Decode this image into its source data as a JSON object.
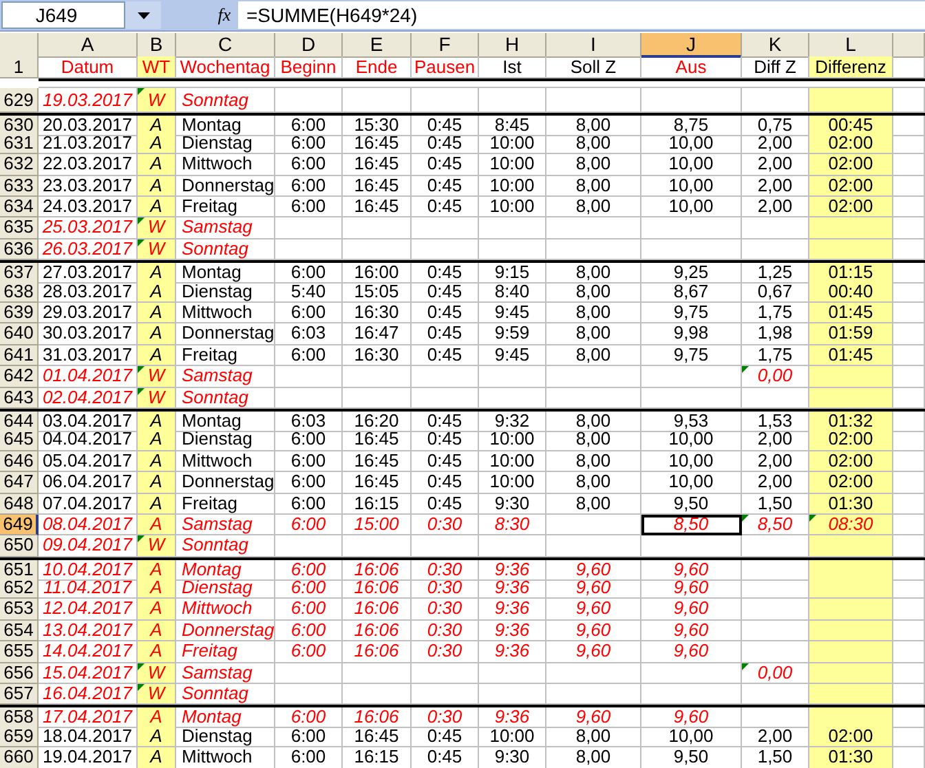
{
  "formula_bar": {
    "name_box": "J649",
    "fx_icon": "fx",
    "formula": "=SUMME(H649*24)"
  },
  "columns": [
    {
      "letter": "A",
      "selected": false,
      "highlight": false
    },
    {
      "letter": "B",
      "selected": false,
      "highlight": true
    },
    {
      "letter": "C",
      "selected": false,
      "highlight": false
    },
    {
      "letter": "D",
      "selected": false,
      "highlight": false
    },
    {
      "letter": "E",
      "selected": false,
      "highlight": false
    },
    {
      "letter": "F",
      "selected": false,
      "highlight": false
    },
    {
      "letter": "H",
      "selected": false,
      "highlight": false
    },
    {
      "letter": "I",
      "selected": false,
      "highlight": false
    },
    {
      "letter": "J",
      "selected": true,
      "highlight": false
    },
    {
      "letter": "K",
      "selected": false,
      "highlight": false
    },
    {
      "letter": "L",
      "selected": false,
      "highlight": true
    }
  ],
  "header_row": {
    "number": "1",
    "cells": [
      {
        "text": "Datum",
        "red": true
      },
      {
        "text": "WT",
        "red": true
      },
      {
        "text": "Wochentag",
        "red": true
      },
      {
        "text": "Beginn",
        "red": true
      },
      {
        "text": "Ende",
        "red": true
      },
      {
        "text": "Pausen",
        "red": true
      },
      {
        "text": "Ist",
        "red": false
      },
      {
        "text": "Soll Z",
        "red": false
      },
      {
        "text": "Aus",
        "red": true
      },
      {
        "text": "Diff Z",
        "red": false
      },
      {
        "text": "Differenz",
        "red": false
      }
    ]
  },
  "rows": [
    {
      "number": "629",
      "kind": "red",
      "selected": false,
      "separator_above": false,
      "comment_marks": {
        "B": true,
        "K": false,
        "L": false
      },
      "cells": {
        "A": "19.03.2017",
        "B": "W",
        "C": "Sonntag"
      }
    },
    {
      "number": "630",
      "kind": "plain",
      "selected": false,
      "separator_above": true,
      "comment_marks": {
        "B": false,
        "K": false,
        "L": false
      },
      "cells": {
        "A": "20.03.2017",
        "B": "A",
        "C": "Montag",
        "D": "6:00",
        "E": "15:30",
        "F": "0:45",
        "H": "8:45",
        "I": "8,00",
        "J": "8,75",
        "K": "0,75",
        "L": "00:45"
      }
    },
    {
      "number": "631",
      "kind": "plain",
      "selected": false,
      "separator_above": false,
      "comment_marks": {
        "B": false,
        "K": false,
        "L": false
      },
      "cells": {
        "A": "21.03.2017",
        "B": "A",
        "C": "Dienstag",
        "D": "6:00",
        "E": "16:45",
        "F": "0:45",
        "H": "10:00",
        "I": "8,00",
        "J": "10,00",
        "K": "2,00",
        "L": "02:00"
      }
    },
    {
      "number": "632",
      "kind": "plain",
      "selected": false,
      "separator_above": false,
      "comment_marks": {
        "B": false,
        "K": false,
        "L": false
      },
      "cells": {
        "A": "22.03.2017",
        "B": "A",
        "C": "Mittwoch",
        "D": "6:00",
        "E": "16:45",
        "F": "0:45",
        "H": "10:00",
        "I": "8,00",
        "J": "10,00",
        "K": "2,00",
        "L": "02:00"
      }
    },
    {
      "number": "633",
      "kind": "plain",
      "selected": false,
      "separator_above": false,
      "comment_marks": {
        "B": false,
        "K": false,
        "L": false
      },
      "cells": {
        "A": "23.03.2017",
        "B": "A",
        "C": "Donnerstag",
        "D": "6:00",
        "E": "16:45",
        "F": "0:45",
        "H": "10:00",
        "I": "8,00",
        "J": "10,00",
        "K": "2,00",
        "L": "02:00"
      }
    },
    {
      "number": "634",
      "kind": "plain",
      "selected": false,
      "separator_above": false,
      "comment_marks": {
        "B": false,
        "K": false,
        "L": false
      },
      "cells": {
        "A": "24.03.2017",
        "B": "A",
        "C": "Freitag",
        "D": "6:00",
        "E": "16:45",
        "F": "0:45",
        "H": "10:00",
        "I": "8,00",
        "J": "10,00",
        "K": "2,00",
        "L": "02:00"
      }
    },
    {
      "number": "635",
      "kind": "red",
      "selected": false,
      "separator_above": false,
      "comment_marks": {
        "B": true,
        "K": false,
        "L": false
      },
      "cells": {
        "A": "25.03.2017",
        "B": "W",
        "C": "Samstag"
      }
    },
    {
      "number": "636",
      "kind": "red",
      "selected": false,
      "separator_above": false,
      "comment_marks": {
        "B": true,
        "K": false,
        "L": false
      },
      "cells": {
        "A": "26.03.2017",
        "B": "W",
        "C": "Sonntag"
      }
    },
    {
      "number": "637",
      "kind": "plain",
      "selected": false,
      "separator_above": true,
      "comment_marks": {
        "B": false,
        "K": false,
        "L": false
      },
      "cells": {
        "A": "27.03.2017",
        "B": "A",
        "C": "Montag",
        "D": "6:00",
        "E": "16:00",
        "F": "0:45",
        "H": "9:15",
        "I": "8,00",
        "J": "9,25",
        "K": "1,25",
        "L": "01:15"
      }
    },
    {
      "number": "638",
      "kind": "plain",
      "selected": false,
      "separator_above": false,
      "comment_marks": {
        "B": false,
        "K": false,
        "L": false
      },
      "cells": {
        "A": "28.03.2017",
        "B": "A",
        "C": "Dienstag",
        "D": "5:40",
        "E": "15:05",
        "F": "0:45",
        "H": "8:40",
        "I": "8,00",
        "J": "8,67",
        "K": "0,67",
        "L": "00:40"
      }
    },
    {
      "number": "639",
      "kind": "plain",
      "selected": false,
      "separator_above": false,
      "comment_marks": {
        "B": false,
        "K": false,
        "L": false
      },
      "cells": {
        "A": "29.03.2017",
        "B": "A",
        "C": "Mittwoch",
        "D": "6:00",
        "E": "16:30",
        "F": "0:45",
        "H": "9:45",
        "I": "8,00",
        "J": "9,75",
        "K": "1,75",
        "L": "01:45"
      }
    },
    {
      "number": "640",
      "kind": "plain",
      "selected": false,
      "separator_above": false,
      "comment_marks": {
        "B": false,
        "K": false,
        "L": false
      },
      "cells": {
        "A": "30.03.2017",
        "B": "A",
        "C": "Donnerstag",
        "D": "6:03",
        "E": "16:47",
        "F": "0:45",
        "H": "9:59",
        "I": "8,00",
        "J": "9,98",
        "K": "1,98",
        "L": "01:59"
      }
    },
    {
      "number": "641",
      "kind": "plain",
      "selected": false,
      "separator_above": false,
      "comment_marks": {
        "B": false,
        "K": false,
        "L": false
      },
      "cells": {
        "A": "31.03.2017",
        "B": "A",
        "C": "Freitag",
        "D": "6:00",
        "E": "16:30",
        "F": "0:45",
        "H": "9:45",
        "I": "8,00",
        "J": "9,75",
        "K": "1,75",
        "L": "01:45"
      }
    },
    {
      "number": "642",
      "kind": "red",
      "selected": false,
      "separator_above": false,
      "comment_marks": {
        "B": true,
        "K": true,
        "L": false
      },
      "cells": {
        "A": "01.04.2017",
        "B": "W",
        "C": "Samstag",
        "K": "0,00"
      }
    },
    {
      "number": "643",
      "kind": "red",
      "selected": false,
      "separator_above": false,
      "comment_marks": {
        "B": true,
        "K": false,
        "L": false
      },
      "cells": {
        "A": "02.04.2017",
        "B": "W",
        "C": "Sonntag"
      }
    },
    {
      "number": "644",
      "kind": "plain",
      "selected": false,
      "separator_above": true,
      "comment_marks": {
        "B": false,
        "K": false,
        "L": false
      },
      "cells": {
        "A": "03.04.2017",
        "B": "A",
        "C": "Montag",
        "D": "6:03",
        "E": "16:20",
        "F": "0:45",
        "H": "9:32",
        "I": "8,00",
        "J": "9,53",
        "K": "1,53",
        "L": "01:32"
      }
    },
    {
      "number": "645",
      "kind": "plain",
      "selected": false,
      "separator_above": false,
      "comment_marks": {
        "B": false,
        "K": false,
        "L": false
      },
      "cells": {
        "A": "04.04.2017",
        "B": "A",
        "C": "Dienstag",
        "D": "6:00",
        "E": "16:45",
        "F": "0:45",
        "H": "10:00",
        "I": "8,00",
        "J": "10,00",
        "K": "2,00",
        "L": "02:00"
      }
    },
    {
      "number": "646",
      "kind": "plain",
      "selected": false,
      "separator_above": false,
      "comment_marks": {
        "B": false,
        "K": false,
        "L": false
      },
      "cells": {
        "A": "05.04.2017",
        "B": "A",
        "C": "Mittwoch",
        "D": "6:00",
        "E": "16:45",
        "F": "0:45",
        "H": "10:00",
        "I": "8,00",
        "J": "10,00",
        "K": "2,00",
        "L": "02:00"
      }
    },
    {
      "number": "647",
      "kind": "plain",
      "selected": false,
      "separator_above": false,
      "comment_marks": {
        "B": false,
        "K": false,
        "L": false
      },
      "cells": {
        "A": "06.04.2017",
        "B": "A",
        "C": "Donnerstag",
        "D": "6:00",
        "E": "16:45",
        "F": "0:45",
        "H": "10:00",
        "I": "8,00",
        "J": "10,00",
        "K": "2,00",
        "L": "02:00"
      }
    },
    {
      "number": "648",
      "kind": "plain",
      "selected": false,
      "separator_above": false,
      "comment_marks": {
        "B": false,
        "K": false,
        "L": false
      },
      "cells": {
        "A": "07.04.2017",
        "B": "A",
        "C": "Freitag",
        "D": "6:00",
        "E": "16:15",
        "F": "0:45",
        "H": "9:30",
        "I": "8,00",
        "J": "9,50",
        "K": "1,50",
        "L": "01:30"
      }
    },
    {
      "number": "649",
      "kind": "red",
      "selected": true,
      "separator_above": false,
      "comment_marks": {
        "B": false,
        "K": true,
        "L": true
      },
      "cells": {
        "A": "08.04.2017",
        "B": "A",
        "C": "Samstag",
        "D": "6:00",
        "E": "15:00",
        "F": "0:30",
        "H": "8:30",
        "J": "8,50",
        "K": "8,50",
        "L": "08:30"
      }
    },
    {
      "number": "650",
      "kind": "red",
      "selected": false,
      "separator_above": false,
      "comment_marks": {
        "B": true,
        "K": false,
        "L": false
      },
      "cells": {
        "A": "09.04.2017",
        "B": "W",
        "C": "Sonntag"
      }
    },
    {
      "number": "651",
      "kind": "red",
      "selected": false,
      "separator_above": true,
      "comment_marks": {
        "B": false,
        "K": false,
        "L": false
      },
      "cells": {
        "A": "10.04.2017",
        "B": "A",
        "C": "Montag",
        "D": "6:00",
        "E": "16:06",
        "F": "0:30",
        "H": "9:36",
        "I": "9,60",
        "J": "9,60"
      }
    },
    {
      "number": "652",
      "kind": "red",
      "selected": false,
      "separator_above": false,
      "comment_marks": {
        "B": false,
        "K": false,
        "L": false
      },
      "cells": {
        "A": "11.04.2017",
        "B": "A",
        "C": "Dienstag",
        "D": "6:00",
        "E": "16:06",
        "F": "0:30",
        "H": "9:36",
        "I": "9,60",
        "J": "9,60"
      }
    },
    {
      "number": "653",
      "kind": "red",
      "selected": false,
      "separator_above": false,
      "comment_marks": {
        "B": false,
        "K": false,
        "L": false
      },
      "cells": {
        "A": "12.04.2017",
        "B": "A",
        "C": "Mittwoch",
        "D": "6:00",
        "E": "16:06",
        "F": "0:30",
        "H": "9:36",
        "I": "9,60",
        "J": "9,60"
      }
    },
    {
      "number": "654",
      "kind": "red",
      "selected": false,
      "separator_above": false,
      "comment_marks": {
        "B": false,
        "K": false,
        "L": false
      },
      "cells": {
        "A": "13.04.2017",
        "B": "A",
        "C": "Donnerstag",
        "D": "6:00",
        "E": "16:06",
        "F": "0:30",
        "H": "9:36",
        "I": "9,60",
        "J": "9,60"
      }
    },
    {
      "number": "655",
      "kind": "red",
      "selected": false,
      "separator_above": false,
      "comment_marks": {
        "B": false,
        "K": false,
        "L": false
      },
      "cells": {
        "A": "14.04.2017",
        "B": "A",
        "C": "Freitag",
        "D": "6:00",
        "E": "16:06",
        "F": "0:30",
        "H": "9:36",
        "I": "9,60",
        "J": "9,60"
      }
    },
    {
      "number": "656",
      "kind": "red",
      "selected": false,
      "separator_above": false,
      "comment_marks": {
        "B": true,
        "K": true,
        "L": false
      },
      "cells": {
        "A": "15.04.2017",
        "B": "W",
        "C": "Samstag",
        "K": "0,00"
      }
    },
    {
      "number": "657",
      "kind": "red",
      "selected": false,
      "separator_above": false,
      "comment_marks": {
        "B": true,
        "K": false,
        "L": false
      },
      "cells": {
        "A": "16.04.2017",
        "B": "W",
        "C": "Sonntag"
      }
    },
    {
      "number": "658",
      "kind": "red",
      "selected": false,
      "separator_above": true,
      "comment_marks": {
        "B": false,
        "K": false,
        "L": false
      },
      "cells": {
        "A": "17.04.2017",
        "B": "A",
        "C": "Montag",
        "D": "6:00",
        "E": "16:06",
        "F": "0:30",
        "H": "9:36",
        "I": "9,60",
        "J": "9,60"
      }
    },
    {
      "number": "659",
      "kind": "plain",
      "selected": false,
      "separator_above": false,
      "comment_marks": {
        "B": false,
        "K": false,
        "L": false
      },
      "cells": {
        "A": "18.04.2017",
        "B": "A",
        "C": "Dienstag",
        "D": "6:00",
        "E": "16:45",
        "F": "0:45",
        "H": "10:00",
        "I": "8,00",
        "J": "10,00",
        "K": "2,00",
        "L": "02:00"
      }
    },
    {
      "number": "660",
      "kind": "plain",
      "selected": false,
      "separator_above": false,
      "comment_marks": {
        "B": false,
        "K": false,
        "L": false
      },
      "cells": {
        "A": "19.04.2017",
        "B": "A",
        "C": "Mittwoch",
        "D": "6:00",
        "E": "16:15",
        "F": "0:45",
        "H": "9:30",
        "I": "8,00",
        "J": "9,50",
        "K": "1,50",
        "L": "01:30"
      }
    }
  ]
}
